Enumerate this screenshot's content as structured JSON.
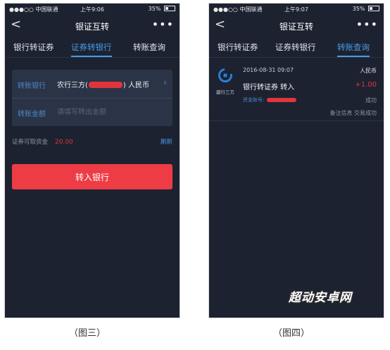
{
  "screens": [
    {
      "status": {
        "carrier": "●●●○○ 中国联通 ",
        "time": "上午9:06",
        "battery": "35%"
      },
      "nav": {
        "back": "<",
        "title": "银证互转",
        "more": "•••"
      },
      "tabs": [
        {
          "label": "银行转证券",
          "active": false
        },
        {
          "label": "证券转银行",
          "active": true
        },
        {
          "label": "转账查询",
          "active": false
        }
      ],
      "form": {
        "bank_label": "转账银行",
        "bank_value_prefix": "农行三方(",
        "bank_value_suffix": ") 人民币",
        "bank_chevron": "›",
        "amount_label": "转账金额",
        "amount_placeholder": "请填写转出金额",
        "amount_value": ""
      },
      "available_label": "证券可取资金",
      "available_amount": "20.00",
      "refresh_label": "刷新",
      "submit_label": "转入银行"
    },
    {
      "status": {
        "carrier": "●●●○○ 中国联通 ",
        "time": "上午9:07",
        "battery": "35%"
      },
      "nav": {
        "back": "<",
        "title": "银证互转",
        "more": "•••"
      },
      "tabs": [
        {
          "label": "银行转证券",
          "active": false
        },
        {
          "label": "证券转银行",
          "active": false
        },
        {
          "label": "转账查询",
          "active": true
        }
      ],
      "record": {
        "org": "建行三方",
        "datetime": "2016-08-31 09:07",
        "currency": "人民币",
        "title": "银行转证券  转入",
        "amount": "+1.00",
        "account_label": "资金账号:",
        "status": "成功",
        "note": "备注信息 交易成功"
      }
    }
  ],
  "captions": [
    "（图三）",
    "（图四）"
  ],
  "watermark": "超动安卓网",
  "colors": {
    "screen_bg": "#1c2230",
    "accent_blue": "#4a9be8",
    "button_red": "#ee3c46",
    "amount_red": "#e0353c"
  },
  "icons": {
    "back": "chevron-left-icon",
    "more": "more-dots-icon",
    "bank_logo": "ccb-logo-icon"
  }
}
